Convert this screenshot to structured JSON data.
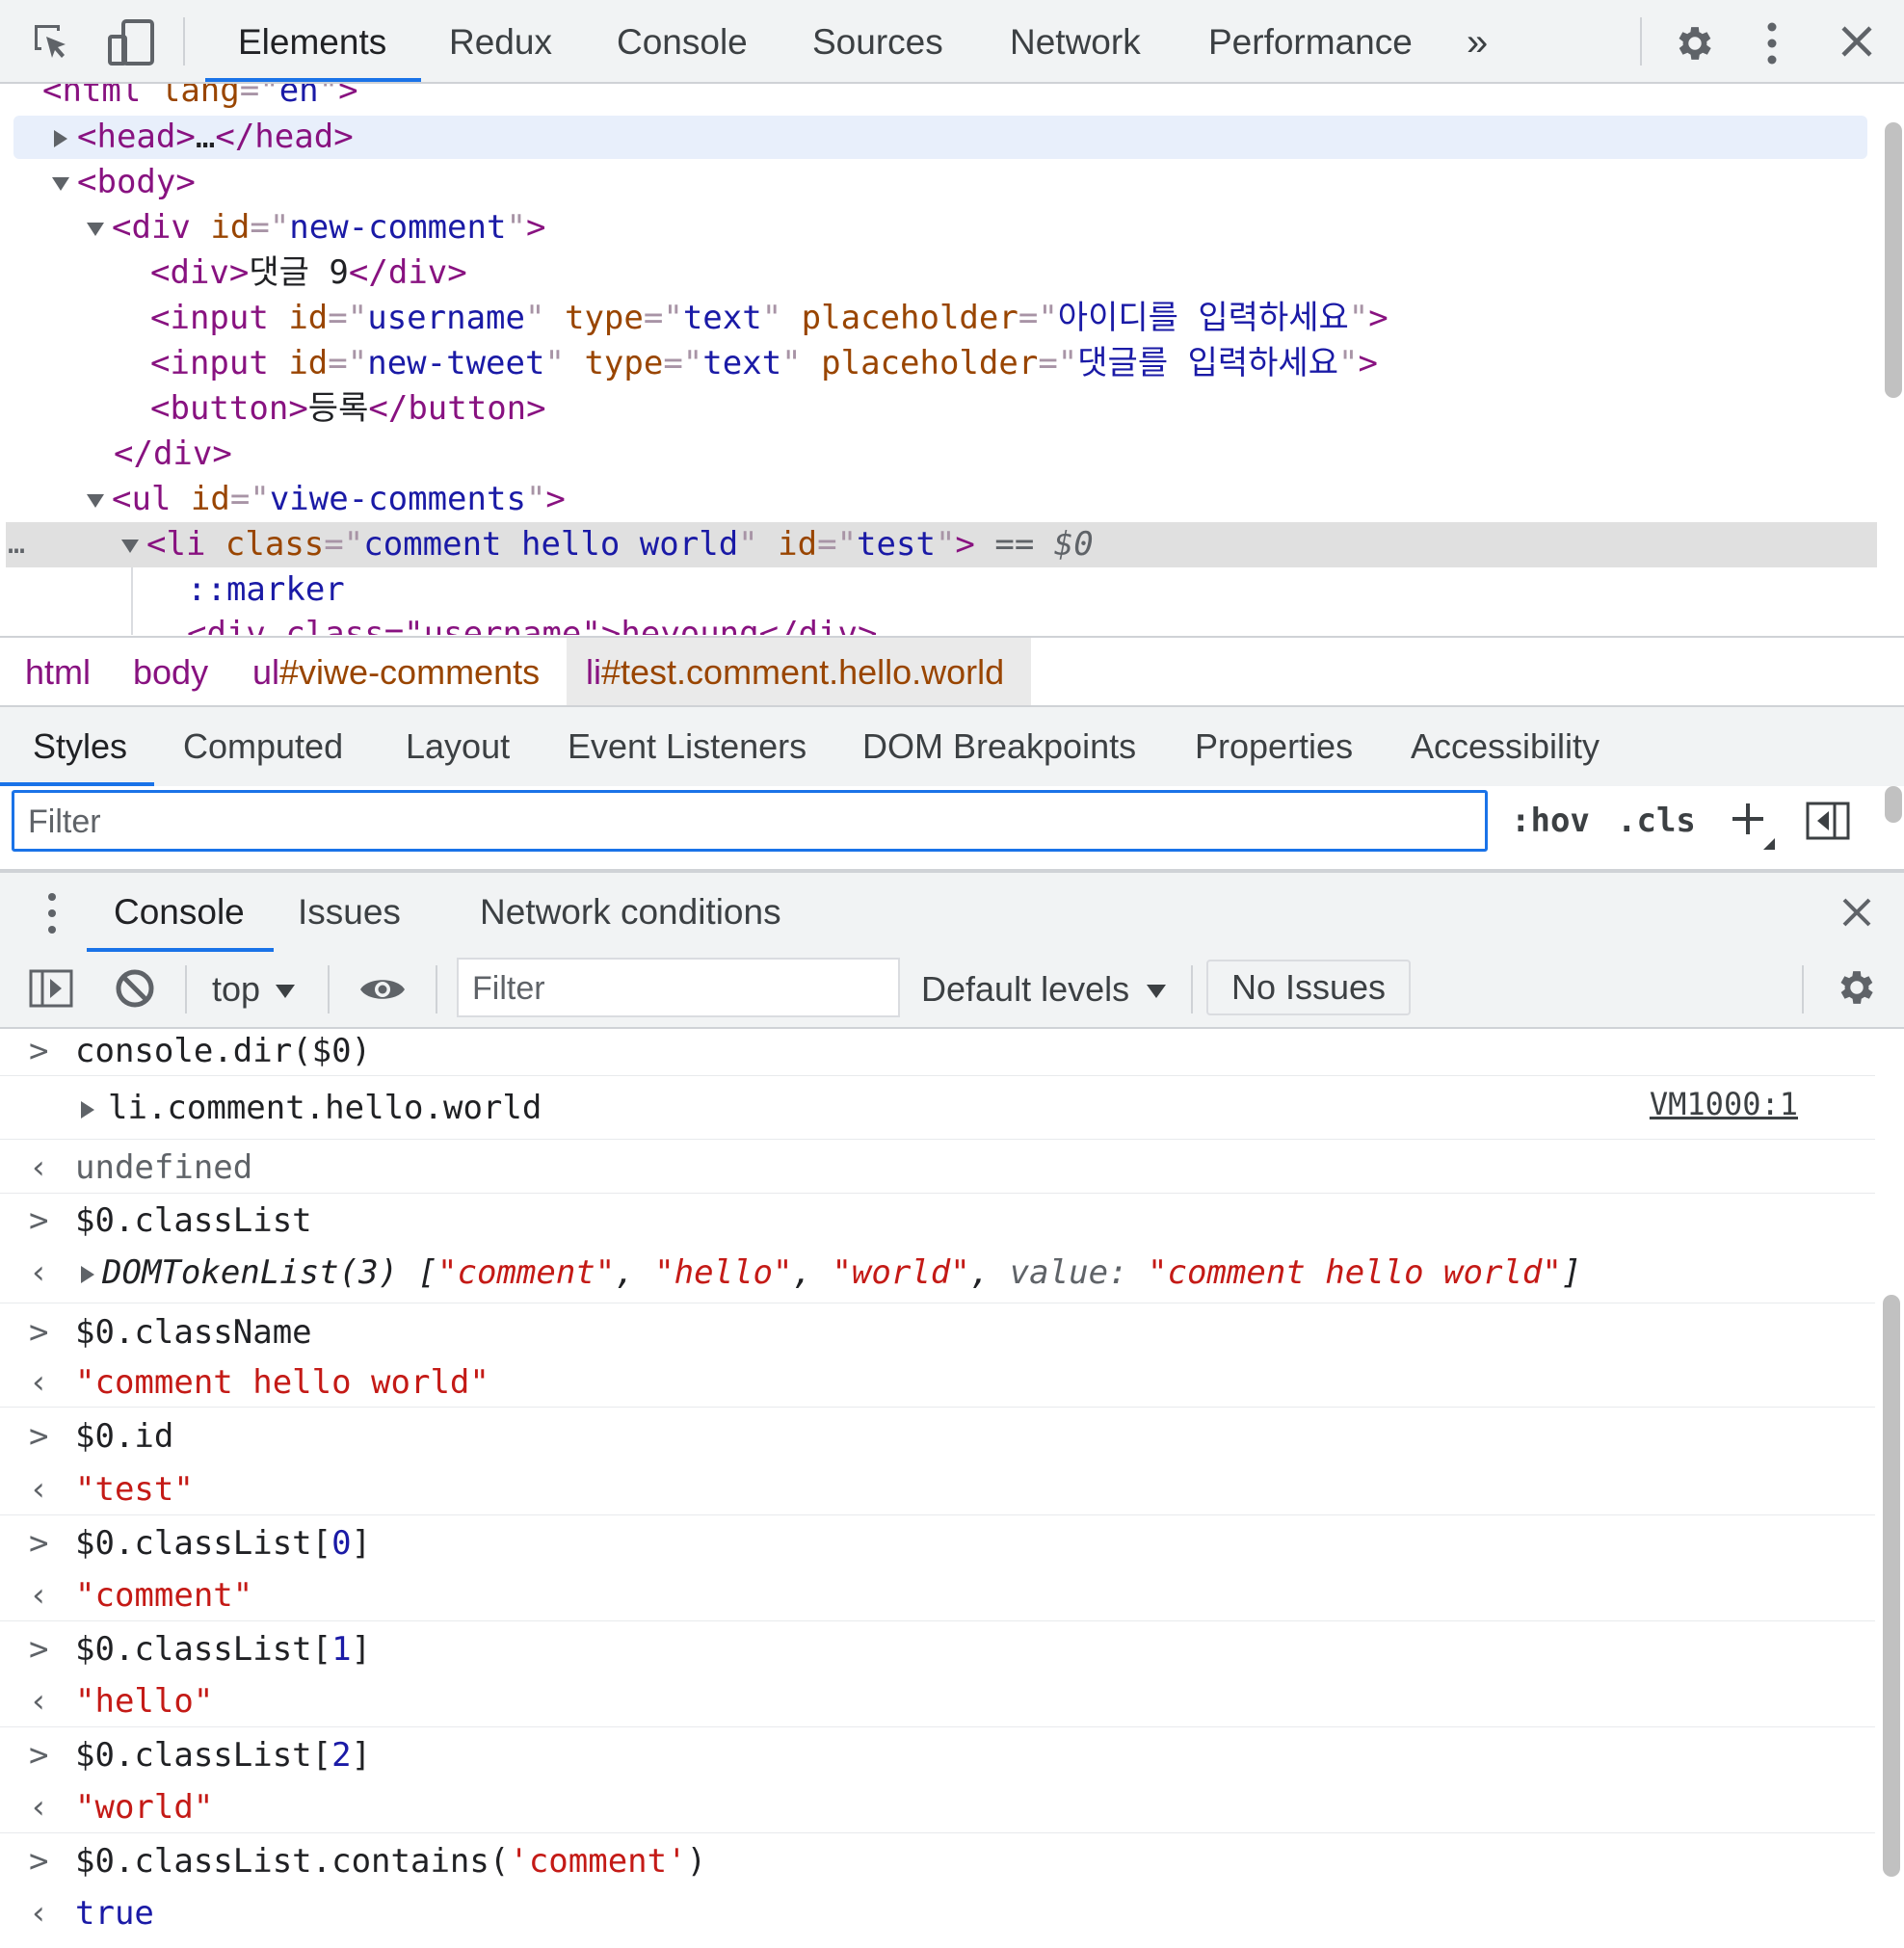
{
  "tabs": [
    "Elements",
    "Redux",
    "Console",
    "Sources",
    "Network",
    "Performance"
  ],
  "tabs_more": "»",
  "tree": {
    "l0_tag": "html",
    "l0_attr": "lang",
    "l0_val": "en",
    "head_open": "head",
    "head_ellipsis": "…",
    "head_close": "/head",
    "body": "body",
    "div_tag": "div",
    "div_attr": "id",
    "div_val": "new-comment",
    "c1_tag": "div",
    "c1_text": "댓글 9",
    "c1_close": "/div",
    "in1_tag": "input",
    "in1_a1": "id",
    "in1_v1": "username",
    "in1_a2": "type",
    "in1_v2": "text",
    "in1_a3": "placeholder",
    "in1_v3": "아이디를 입력하세요",
    "in2_tag": "input",
    "in2_a1": "id",
    "in2_v1": "new-tweet",
    "in2_a2": "type",
    "in2_v2": "text",
    "in2_a3": "placeholder",
    "in2_v3": "댓글를 입력하세요",
    "btn_tag": "button",
    "btn_text": "등록",
    "btn_close": "/button",
    "div_close": "/div",
    "ul_tag": "ul",
    "ul_attr": "id",
    "ul_val": "viwe-comments",
    "li_tag": "li",
    "li_a1": "class",
    "li_v1": "comment hello world",
    "li_a2": "id",
    "li_v2": "test",
    "li_eq": "== $0",
    "marker": "::marker",
    "cut_line": "<div class=\"username\">heyoung</div>",
    "more": "…"
  },
  "breadcrumbs": [
    "html",
    "body",
    "ul#viwe-comments",
    "li#test.comment.hello.world"
  ],
  "breadcrumb_parts": {
    "li_tag": "li",
    "li_rest": "#test.comment.hello.world",
    "ul_tag": "ul",
    "ul_rest": "#viwe-comments"
  },
  "sidebar_tabs": [
    "Styles",
    "Computed",
    "Layout",
    "Event Listeners",
    "DOM Breakpoints",
    "Properties",
    "Accessibility"
  ],
  "styles_filter_placeholder": "Filter",
  "hov": ":hov",
  "cls": ".cls",
  "drawer_tabs": [
    "Console",
    "Issues",
    "Network conditions"
  ],
  "console_toolbar": {
    "context": "top",
    "filter_placeholder": "Filter",
    "levels": "Default levels",
    "issues": "No Issues"
  },
  "console": {
    "e1_in": "console.dir($0)",
    "e2_obj": "li.comment.hello.world",
    "e2_link": "VM1000:1",
    "e3_out": "undefined",
    "e4_in": "$0.classList",
    "e5_type": "DOMTokenList(3)",
    "e5_s1": "\"comment\"",
    "e5_s2": "\"hello\"",
    "e5_s3": "\"world\"",
    "e5_key": "value:",
    "e5_s4": "\"comment hello world\"",
    "e6_in": "$0.className",
    "e7_out": "\"comment hello world\"",
    "e8_in": "$0.id",
    "e9_out": "\"test\"",
    "e10_in": "$0.classList[",
    "e10_idx": "0",
    "e11_out": "\"comment\"",
    "e12_in": "$0.classList[",
    "e12_idx": "1",
    "e13_out": "\"hello\"",
    "e14_in": "$0.classList[",
    "e14_idx": "2",
    "e15_out": "\"world\"",
    "e16_in": "$0.classList.contains(",
    "e16_arg": "'comment'",
    "e17_out": "true"
  },
  "colors": {
    "accent": "#1a73e8",
    "tag": "#881280",
    "attr_name": "#994500",
    "attr_value": "#1a1aa6",
    "string": "#c41a16"
  }
}
